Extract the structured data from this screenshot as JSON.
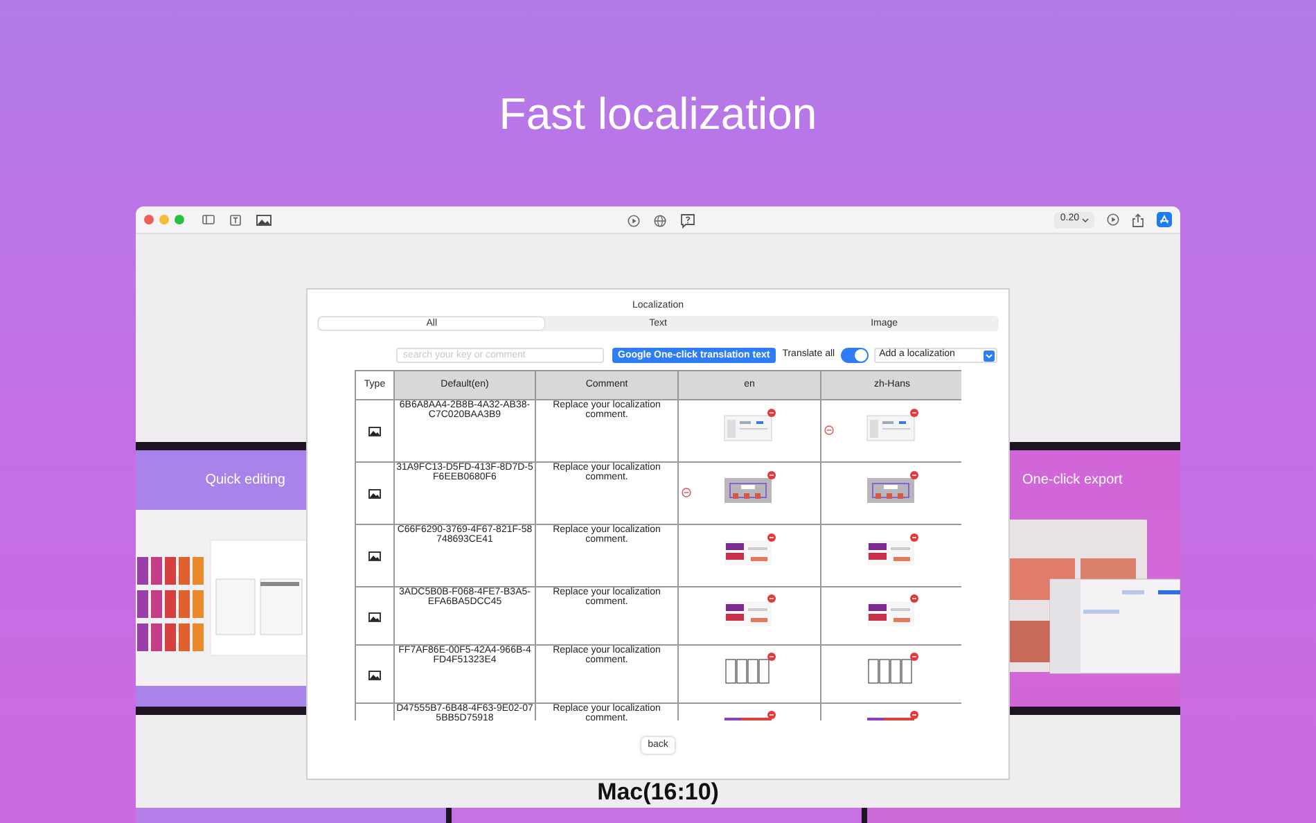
{
  "headline": "Fast localization",
  "toolbar": {
    "zoom": "0.20"
  },
  "canvas": {
    "cards": [
      {
        "kind": "editing",
        "title": "Quick editing"
      },
      {
        "kind": "export",
        "title": "One-click export"
      }
    ],
    "caption": "Mac(16:10)"
  },
  "dialog": {
    "title": "Localization",
    "tabs": [
      {
        "label": "All",
        "selected": true
      },
      {
        "label": "Text",
        "selected": false
      },
      {
        "label": "Image",
        "selected": false
      }
    ],
    "search": {
      "placeholder": "search your key or comment"
    },
    "translate_button": "Google One-click translation text",
    "translate_all": {
      "label": "Translate all",
      "on": true
    },
    "add_localization": {
      "value": "Add a localization"
    },
    "table": {
      "columns": [
        "Type",
        "Default(en)",
        "Comment",
        "en",
        "zh-Hans"
      ],
      "rows": [
        {
          "key": "6B6A8AA4-2B8B-4A32-AB38-C7C020BAA3B9",
          "comment": "Replace your localization comment.",
          "kind": "window",
          "en_marked": false,
          "zh_marked": true
        },
        {
          "key": "31A9FC13-D5FD-413F-8D7D-5F6EEB0680F6",
          "comment": "Replace your localization comment.",
          "kind": "panel",
          "en_marked": true,
          "zh_marked": false
        },
        {
          "key": "C66F6290-3769-4F67-821F-58748693CE41",
          "comment": "Replace your localization comment.",
          "kind": "cards",
          "en_marked": false,
          "zh_marked": false
        },
        {
          "key": "3ADC5B0B-F068-4FE7-B3A5-EFA6BA5DCC45",
          "comment": "Replace your localization comment.",
          "kind": "cards",
          "en_marked": false,
          "zh_marked": false
        },
        {
          "key": "FF7AF86E-00F5-42A4-966B-4FD4F51323E4",
          "comment": "Replace your localization comment.",
          "kind": "phones",
          "en_marked": false,
          "zh_marked": false
        },
        {
          "key": "D47555B7-6B48-4F63-9E02-075BB5D75918",
          "comment": "Replace your localization comment.",
          "kind": "banner"
        }
      ]
    },
    "back_button": "back"
  }
}
